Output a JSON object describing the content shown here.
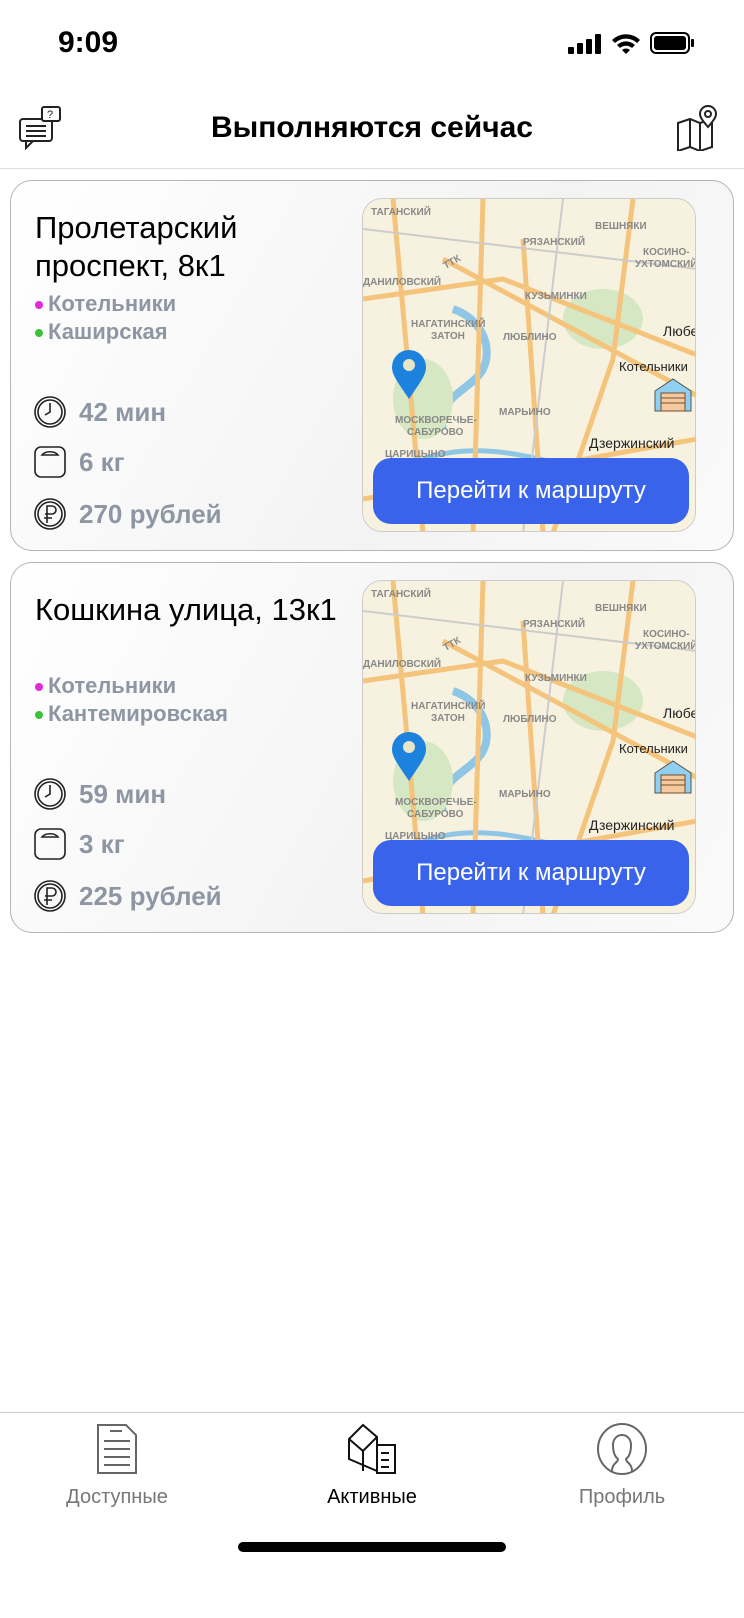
{
  "status_bar": {
    "time": "9:09"
  },
  "header": {
    "title": "Выполняются сейчас",
    "left_icon": "chat-question-icon",
    "right_icon": "map-pin-icon"
  },
  "accent_color": "#3a63ec",
  "orders": [
    {
      "address": "Пролетарский проспект, 8к1",
      "metro": [
        {
          "name": "Котельники",
          "color": "#e02bd6"
        },
        {
          "name": "Каширская",
          "color": "#3cc13b"
        }
      ],
      "time": "42 мин",
      "weight": "6 кг",
      "price": "270 рублей",
      "button": "Перейти к маршруту"
    },
    {
      "address": "Кошкина улица, 13к1",
      "metro": [
        {
          "name": "Котельники",
          "color": "#e02bd6"
        },
        {
          "name": "Кантемировская",
          "color": "#3cc13b"
        }
      ],
      "time": "59 мин",
      "weight": "3 кг",
      "price": "225 рублей",
      "button": "Перейти к маршруту"
    }
  ],
  "map_labels": {
    "taganskiy": "ТАГАНСКИЙ",
    "veshnyaki": "ВЕШНЯКИ",
    "ryazanskiy": "РЯЗАНСКИЙ",
    "kosino": "КОСИНО-",
    "ukhtomskiy": "УХТОМСКИЙ",
    "ttk": "ТТК",
    "danilovskiy": "ДАНИЛОВСКИЙ",
    "kuzminki": "КУЗЬМИНКИ",
    "nagatinskiy": "НАГАТИНСКИЙ",
    "zaton": "ЗАТОН",
    "lyublino": "ЛЮБЛИНО",
    "lyube": "Любе",
    "kotelniki": "Котельники",
    "marino": "МАРЬИНО",
    "moskvorechye": "МОСКВОРЕЧЬЕ-",
    "saburovo": "САБУРОВО",
    "dzerzhinskiy": "Дзержинский",
    "tsaritsyno": "ЦАРИЦЫНО"
  },
  "tabs": [
    {
      "label": "Доступные",
      "active": false
    },
    {
      "label": "Активные",
      "active": true
    },
    {
      "label": "Профиль",
      "active": false
    }
  ]
}
